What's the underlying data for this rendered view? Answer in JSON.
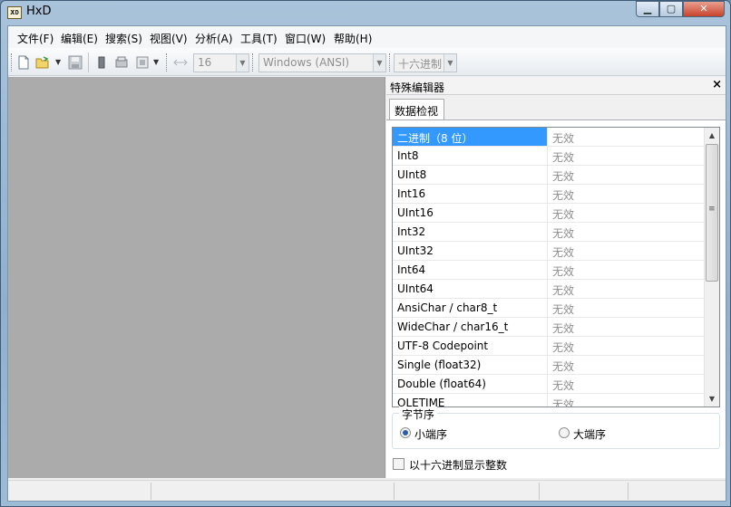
{
  "window": {
    "title": "HxD",
    "logo_text": "HxD"
  },
  "menu": [
    {
      "label": "文件(F)"
    },
    {
      "label": "编辑(E)"
    },
    {
      "label": "搜索(S)"
    },
    {
      "label": "视图(V)"
    },
    {
      "label": "分析(A)"
    },
    {
      "label": "工具(T)"
    },
    {
      "label": "窗口(W)"
    },
    {
      "label": "帮助(H)"
    }
  ],
  "toolbar": {
    "bytes_per_row": "16",
    "encoding": "Windows (ANSI)",
    "offset_base": "十六进制",
    "icons": [
      "new-file-icon",
      "open-folder-icon",
      "save-icon",
      "memory-icon",
      "disk-icon",
      "properties-icon",
      "columns-icon"
    ]
  },
  "panel": {
    "title": "特殊编辑器",
    "close_glyph": "×",
    "tab": "数据检视",
    "rows": [
      {
        "name": "二进制（8 位）",
        "value": "无效"
      },
      {
        "name": "Int8",
        "value": "无效"
      },
      {
        "name": "UInt8",
        "value": "无效"
      },
      {
        "name": "Int16",
        "value": "无效"
      },
      {
        "name": "UInt16",
        "value": "无效"
      },
      {
        "name": "Int32",
        "value": "无效"
      },
      {
        "name": "UInt32",
        "value": "无效"
      },
      {
        "name": "Int64",
        "value": "无效"
      },
      {
        "name": "UInt64",
        "value": "无效"
      },
      {
        "name": "AnsiChar / char8_t",
        "value": "无效"
      },
      {
        "name": "WideChar / char16_t",
        "value": "无效"
      },
      {
        "name": "UTF-8 Codepoint",
        "value": "无效"
      },
      {
        "name": "Single (float32)",
        "value": "无效"
      },
      {
        "name": "Double (float64)",
        "value": "无效"
      },
      {
        "name": "OLETIME",
        "value": "无效"
      }
    ],
    "byte_order": {
      "legend": "字节序",
      "little_endian": "小端序",
      "big_endian": "大端序",
      "selected": "小端序"
    },
    "hex_checkbox_label": "以十六进制显示整数",
    "hex_checkbox_checked": false
  },
  "colors": {
    "selection": "#3399ff",
    "hex_area": "#ababab",
    "invalid_text": "#8d8d8d"
  }
}
